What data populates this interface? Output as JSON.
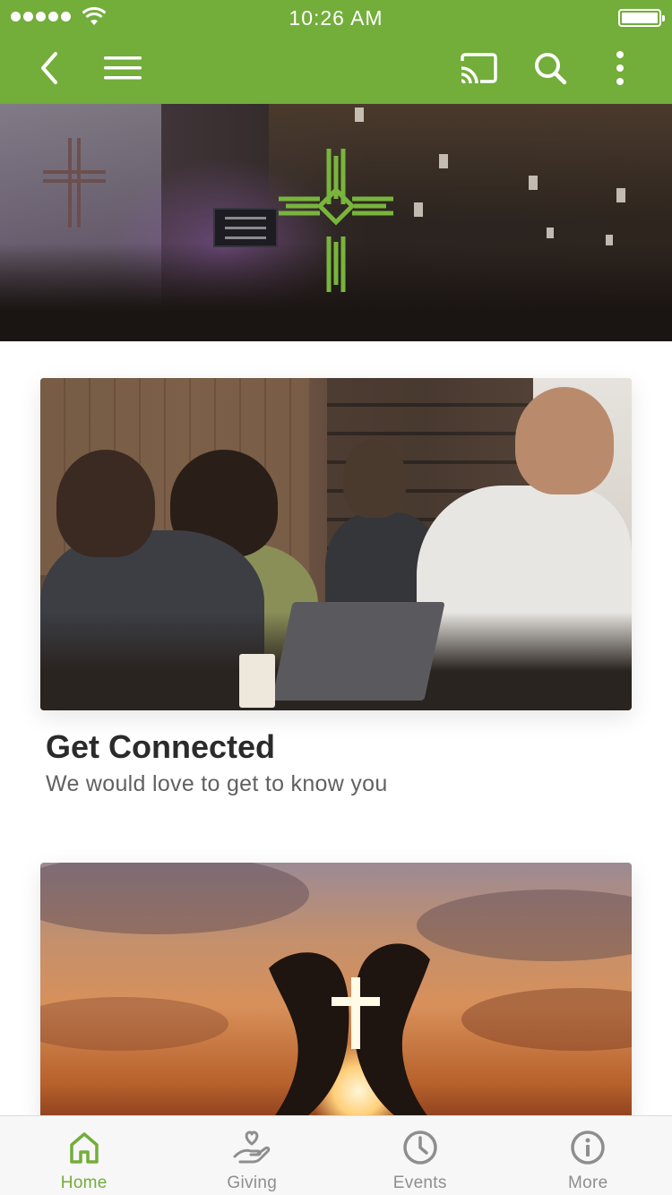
{
  "status_bar": {
    "time": "10:26 AM"
  },
  "colors": {
    "brand": "#73ad3a",
    "tab_inactive": "#8e8e8e",
    "title": "#2b2b2b",
    "subtitle": "#616161"
  },
  "nav": {
    "icons": [
      "back-icon",
      "menu-icon",
      "cast-icon",
      "search-icon",
      "more-vertical-icon"
    ]
  },
  "hero": {
    "logo_icon": "cross-logo-icon"
  },
  "cards": [
    {
      "title": "Get Connected",
      "subtitle": "We would love to get to know you"
    },
    {
      "title": "",
      "subtitle": ""
    }
  ],
  "tabs": [
    {
      "label": "Home",
      "icon": "home-icon",
      "active": true
    },
    {
      "label": "Giving",
      "icon": "giving-hand-heart-icon",
      "active": false
    },
    {
      "label": "Events",
      "icon": "clock-icon",
      "active": false
    },
    {
      "label": "More",
      "icon": "info-icon",
      "active": false
    }
  ]
}
